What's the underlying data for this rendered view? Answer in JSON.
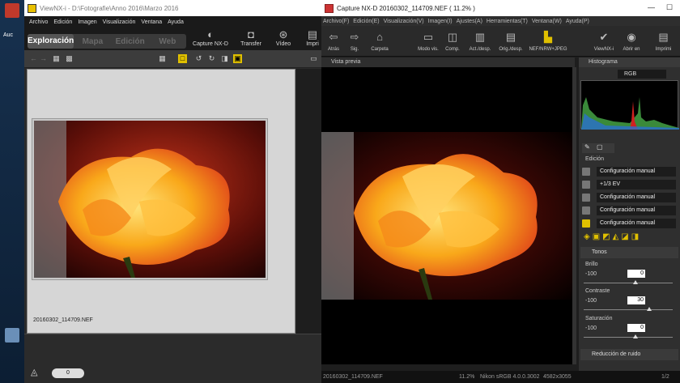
{
  "desktop": {
    "label": "Auc"
  },
  "viewnx": {
    "title": "ViewNX-i - D:\\Fotografie\\Anno 2016\\Marzo 2016",
    "menu": [
      "Archivo",
      "Edición",
      "Imagen",
      "Visualización",
      "Ventana",
      "Ayuda"
    ],
    "modes": [
      "Exploración",
      "Mapa",
      "Edición",
      "Web"
    ],
    "buttons": {
      "capture": "Capture NX-D",
      "transfer": "Transfer",
      "video": "Vídeo",
      "imprimir": "Impri"
    },
    "filename": "20160302_114709.NEF",
    "rating_value": "0"
  },
  "capture": {
    "title": "Capture NX-D   20160302_114709.NEF ( 11.2% )",
    "menu": [
      "Archivo(F)",
      "Edición(E)",
      "Visualización(V)",
      "Imagen(I)",
      "Ajustes(A)",
      "Herramientas(T)",
      "Ventana(W)",
      "Ayuda(P)"
    ],
    "toolbar": [
      "Atrás",
      "Sig.",
      "Carpeta",
      "Modo vis.",
      "Comp.",
      "Act./desp.",
      "Orig./desp.",
      "NEF/NRW+JPEG",
      "ViewNX-i",
      "Abrir en",
      "Imprimi"
    ],
    "preview_label": "Vista previa",
    "histogram": {
      "title": "Histograma",
      "channel": "RGB"
    },
    "edit_label": "Edición",
    "settings": [
      "Configuración manual",
      "+1/3 EV",
      "Configuración manual",
      "Configuración manual",
      "Configuración manual"
    ],
    "tonos": "Tonos",
    "sliders": [
      {
        "label": "Brillo",
        "min": "-100",
        "value": "0"
      },
      {
        "label": "Contraste",
        "min": "-100",
        "value": "30"
      },
      {
        "label": "Saturación",
        "min": "-100",
        "value": "0"
      }
    ],
    "noise": "Reducción de ruido",
    "status": {
      "file": "20160302_114709.NEF",
      "zoom": "11.2%",
      "profile": "Nikon sRGB 4.0.0.3002",
      "dims": "4582x3055",
      "page": "1/2"
    }
  }
}
